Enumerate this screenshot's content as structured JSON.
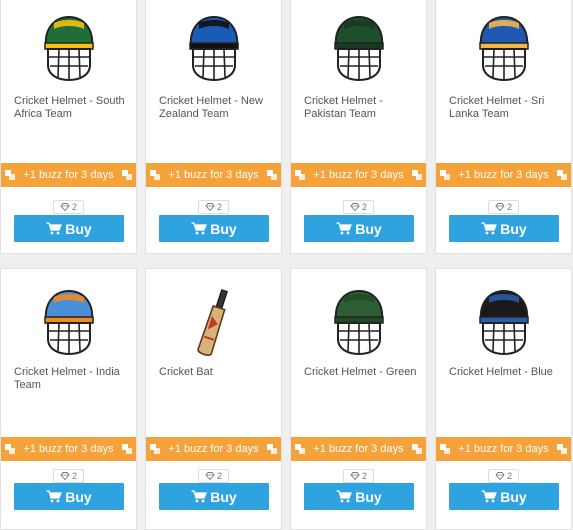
{
  "products": [
    {
      "title": "Cricket Helmet - South Africa Team",
      "icon": "helmet-south-africa",
      "colors": [
        "#1f6e3a",
        "#f1c20f"
      ]
    },
    {
      "title": "Cricket Helmet - New Zealand Team",
      "icon": "helmet-new-zealand",
      "colors": [
        "#1c5bb5",
        "#111111"
      ]
    },
    {
      "title": "Cricket Helmet - Pakistan Team",
      "icon": "helmet-pakistan",
      "colors": [
        "#1d4f2a",
        "#173a22"
      ]
    },
    {
      "title": "Cricket Helmet - Sri Lanka Team",
      "icon": "helmet-sri-lanka",
      "colors": [
        "#1e58b0",
        "#f2b84b"
      ]
    },
    {
      "title": "Cricket Helmet - India Team",
      "icon": "helmet-india",
      "colors": [
        "#4a90d9",
        "#f08a24"
      ]
    },
    {
      "title": "Cricket Bat",
      "icon": "cricket-bat",
      "colors": [
        "#c9a066",
        "#c0392b"
      ]
    },
    {
      "title": "Cricket Helmet - Green",
      "icon": "helmet-green",
      "colors": [
        "#2e5f34",
        "#234a28"
      ]
    },
    {
      "title": "Cricket Helmet - Blue",
      "icon": "helmet-blue",
      "colors": [
        "#1a1a1a",
        "#2b5aa8"
      ]
    }
  ],
  "promo_label": "+1 buzz for 3 days",
  "price": "2",
  "buy_label": "Buy",
  "theme": {
    "promo": "#f6a23a",
    "buy": "#2fa3e0"
  }
}
